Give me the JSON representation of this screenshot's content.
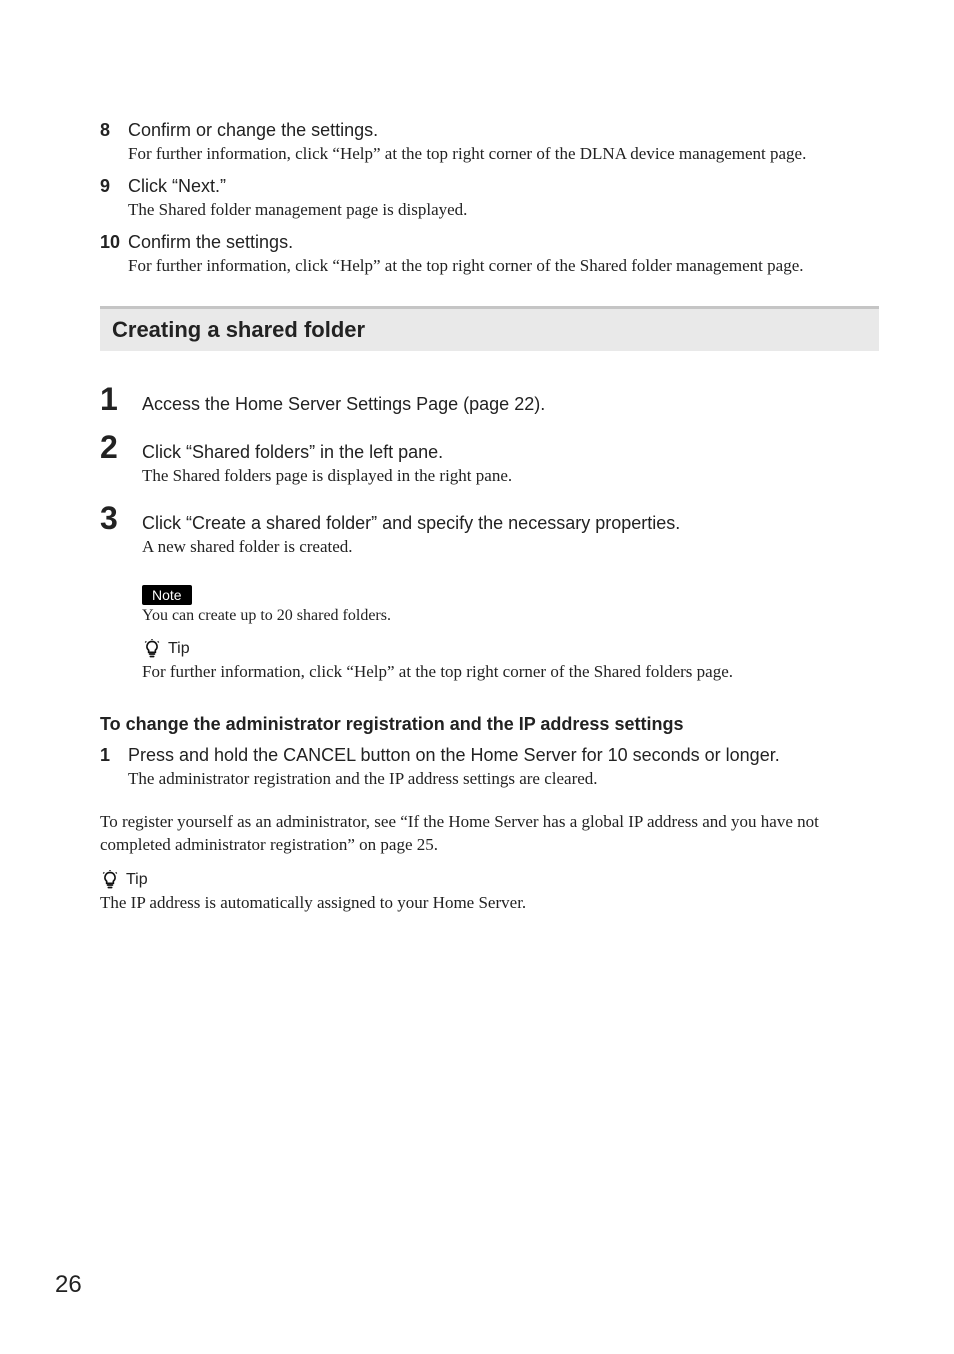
{
  "steps_top": [
    {
      "num": "8",
      "title": "Confirm or change the settings.",
      "body": "For further information, click “Help” at the top right corner of the DLNA device management page."
    },
    {
      "num": "9",
      "title": "Click “Next.”",
      "body": "The Shared folder management page is displayed."
    },
    {
      "num": "10",
      "title": "Confirm the settings.",
      "body": "For further information, click “Help” at the top right corner of the Shared folder management page."
    }
  ],
  "section_header": "Creating a shared folder",
  "big_steps": [
    {
      "num": "1",
      "title": "Access the Home Server Settings Page (page 22).",
      "desc": ""
    },
    {
      "num": "2",
      "title": "Click “Shared folders” in the left pane.",
      "desc": "The Shared folders page is displayed in the right pane."
    },
    {
      "num": "3",
      "title": "Click “Create a shared folder” and specify the necessary properties.",
      "desc": "A new shared folder is created."
    }
  ],
  "note": {
    "label": "Note",
    "text": "You can create up to 20 shared folders."
  },
  "tip1": {
    "label": "Tip",
    "text": "For further information, click “Help” at the top right corner of the Shared folders page."
  },
  "subheading": "To change the administrator registration and the IP address settings",
  "substep": {
    "num": "1",
    "title": "Press and hold the CANCEL button on the Home Server for 10 seconds or longer.",
    "body": "The administrator registration and the IP address settings are cleared."
  },
  "para": "To register yourself as an administrator, see “If the Home Server has a global IP address and you have not completed administrator registration” on page 25.",
  "tip2": {
    "label": "Tip",
    "text": "The IP address is automatically assigned to your Home Server."
  },
  "page_number": "26"
}
